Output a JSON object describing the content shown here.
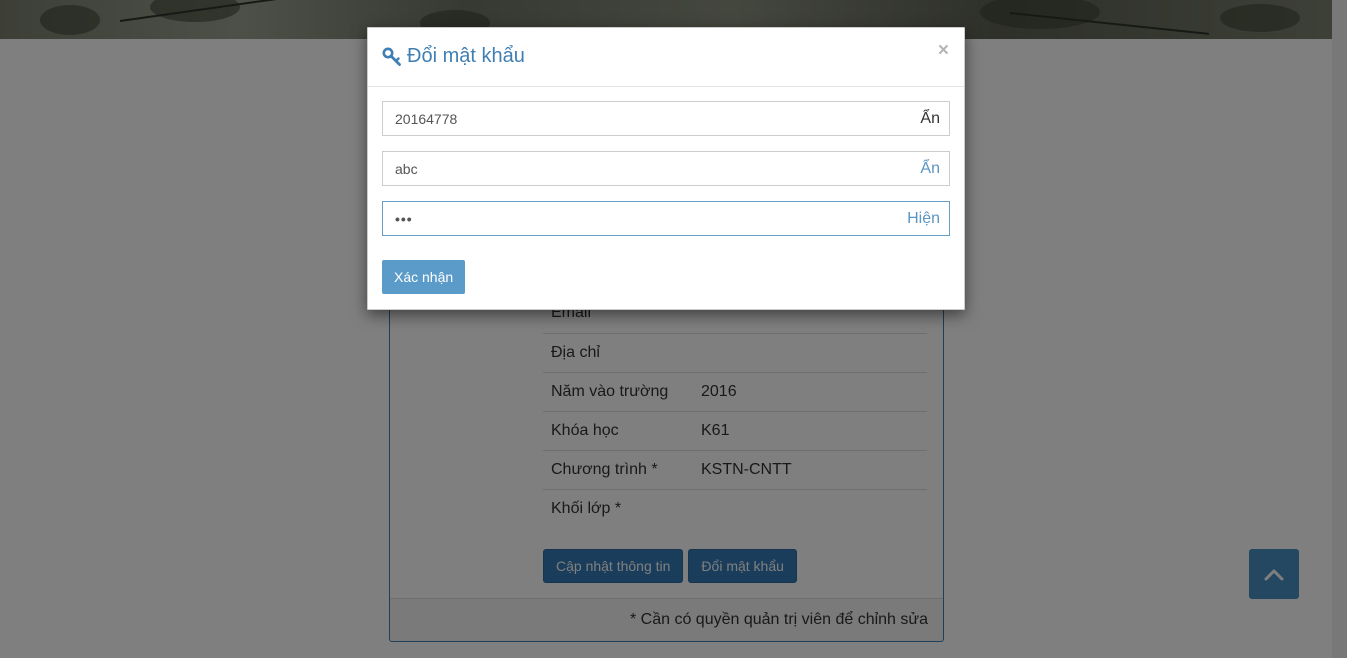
{
  "page": {
    "info_rows": [
      {
        "label": "Email",
        "value": ""
      },
      {
        "label": "Địa chỉ",
        "value": ""
      },
      {
        "label": "Năm vào trường",
        "value": "2016"
      },
      {
        "label": "Khóa học",
        "value": "K61"
      },
      {
        "label": "Chương trình *",
        "value": "KSTN-CNTT"
      },
      {
        "label": "Khối lớp *",
        "value": ""
      }
    ],
    "update_button": "Cập nhật thông tin",
    "change_password_button": "Đổi mật khẩu",
    "footer_note": "* Cần có quyền quản trị viên để chỉnh sửa",
    "back_to_top_icon": "chevron-up-icon"
  },
  "modal": {
    "title": "Đổi mật khẩu",
    "title_icon": "key-icon",
    "close_label": "×",
    "fields": [
      {
        "value": "20164778",
        "toggle": "Ẩn"
      },
      {
        "value": "abc",
        "toggle": "Ẩn"
      },
      {
        "value": "•••",
        "toggle": "Hiện"
      }
    ],
    "submit_label": "Xác nhận"
  },
  "colors": {
    "primary": "#337ab7",
    "modal_accent": "#3f7fb3",
    "submit": "#5b9bc9"
  }
}
